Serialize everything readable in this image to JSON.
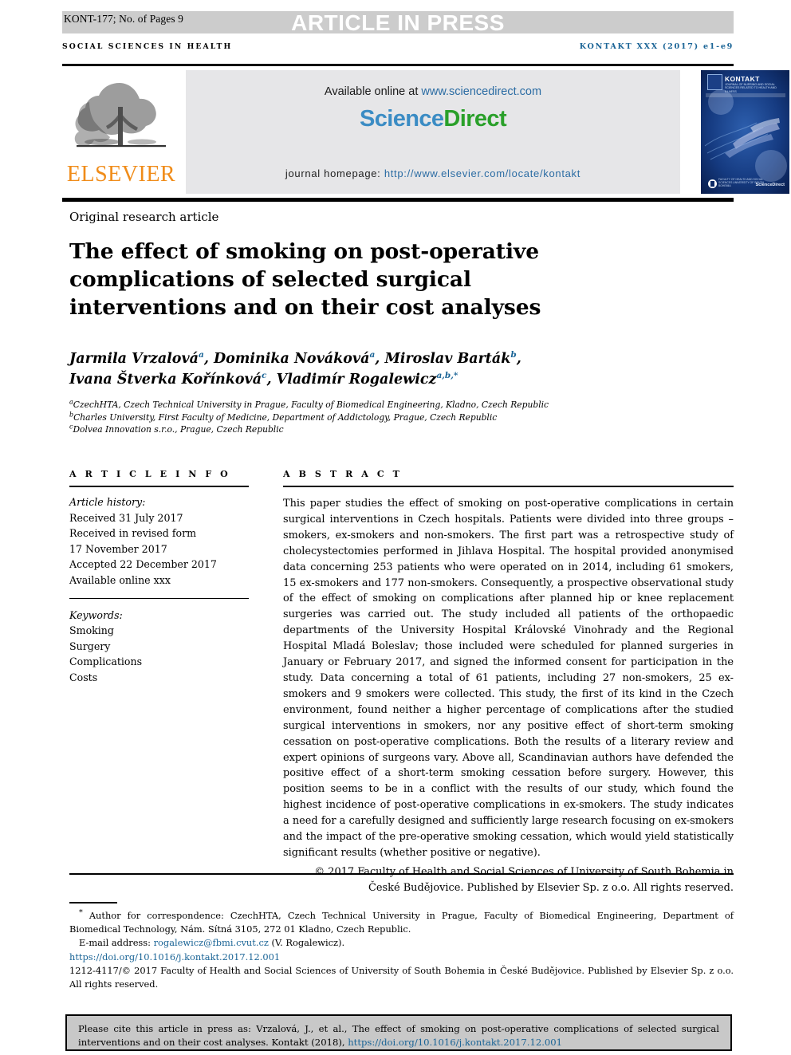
{
  "runhead": {
    "article_id": "KONT-177; No. of Pages 9",
    "press_banner": "ARTICLE IN PRESS",
    "journal_section": "SOCIAL SCIENCES IN HEALTH",
    "journal_citation": "KONTAKT XXX (2017) e1-e9"
  },
  "masthead": {
    "publisher": "ELSEVIER",
    "available_prefix": "Available online at ",
    "available_url": "www.sciencedirect.com",
    "logo_part1": "Science",
    "logo_part2": "Direct",
    "homepage_label": "journal homepage: ",
    "homepage_url": "http://www.elsevier.com/locate/kontakt",
    "cover_title": "KONTAKT",
    "cover_subtitle": "JOURNAL OF NURSING AND SOCIAL SCIENCES RELATED TO HEALTH AND ILLNESS",
    "cover_footer": "FACULTY OF HEALTH AND SOCIAL SCIENCES UNIVERSITY OF SOUTH BOHEMIA",
    "cover_sciencedirect": "ScienceDirect"
  },
  "article": {
    "type": "Original research article",
    "title": "The effect of smoking on post-operative complications of selected surgical interventions and on their cost analyses",
    "authors_line1_name1": "Jarmila Vrzalová",
    "authors_line1_sup1": "a",
    "authors_line1_name2": "Dominika Nováková",
    "authors_line1_sup2": "a",
    "authors_line1_name3": "Miroslav Barták",
    "authors_line1_sup3": "b",
    "authors_line2_name1": "Ivana Štverka Kořínková",
    "authors_line2_sup1": "c",
    "authors_line2_name2": "Vladimír Rogalewicz",
    "authors_line2_sup2": "a,b,*",
    "affiliations": [
      {
        "marker": "a",
        "text": "CzechHTA, Czech Technical University in Prague, Faculty of Biomedical Engineering, Kladno, Czech Republic"
      },
      {
        "marker": "b",
        "text": "Charles University, First Faculty of Medicine, Department of Addictology, Prague, Czech Republic"
      },
      {
        "marker": "c",
        "text": "Dolvea Innovation s.r.o., Prague, Czech Republic"
      }
    ]
  },
  "info": {
    "heading": "A R T I C L E    I N F O",
    "history_label": "Article history:",
    "history": [
      "Received 31 July 2017",
      "Received in revised form",
      "17 November 2017",
      "Accepted 22 December 2017",
      "Available online xxx"
    ],
    "keywords_label": "Keywords:",
    "keywords": [
      "Smoking",
      "Surgery",
      "Complications",
      "Costs"
    ]
  },
  "abstract": {
    "heading": "A B S T R A C T",
    "body": "This paper studies the effect of smoking on post-operative complications in certain surgical interventions in Czech hospitals. Patients were divided into three groups – smokers, ex-smokers and non-smokers. The first part was a retrospective study of cholecystectomies performed in Jihlava Hospital. The hospital provided anonymised data concerning 253 patients who were operated on in 2014, including 61 smokers, 15 ex-smokers and 177 non-smokers. Consequently, a prospective observational study of the effect of smoking on complications after planned hip or knee replacement surgeries was carried out. The study included all patients of the orthopaedic departments of the University Hospital Královské Vinohrady and the Regional Hospital Mladá Boleslav; those included were scheduled for planned surgeries in January or February 2017, and signed the informed consent for participation in the study. Data concerning a total of 61 patients, including 27 non-smokers, 25 ex-smokers and 9 smokers were collected. This study, the first of its kind in the Czech environment, found neither a higher percentage of complications after the studied surgical interventions in smokers, nor any positive effect of short-term smoking cessation on post-operative complications. Both the results of a literary review and expert opinions of surgeons vary. Above all, Scandinavian authors have defended the positive effect of a short-term smoking cessation before surgery. However, this position seems to be in a conflict with the results of our study, which found the highest incidence of post-operative complications in ex-smokers. The study indicates a need for a carefully designed and sufficiently large research focusing on ex-smokers and the impact of the pre-operative smoking cessation, which would yield statistically significant results (whether positive or negative).",
    "copyright": "© 2017 Faculty of Health and Social Sciences of University of South Bohemia in České Budějovice. Published by Elsevier Sp. z o.o. All rights reserved."
  },
  "footnote": {
    "correspondence_marker": "*",
    "correspondence": "Author for correspondence: CzechHTA, Czech Technical University in Prague, Faculty of Biomedical Engineering, Department of Biomedical Technology, Nám. Sítná 3105, 272 01 Kladno, Czech Republic.",
    "email_label": "E-mail address: ",
    "email": "rogalewicz@fbmi.cvut.cz",
    "email_suffix": " (V. Rogalewicz).",
    "doi": "https://doi.org/10.1016/j.kontakt.2017.12.001",
    "issn_line": "1212-4117/© 2017 Faculty of Health and Social Sciences of University of South Bohemia in České Budějovice. Published by Elsevier Sp. z o.o. All rights reserved."
  },
  "citation_box": {
    "text": "Please cite this article in press as: Vrzalová, J., et al., The effect of smoking on post-operative complications of selected surgical interventions and on their cost analyses. Kontakt (2018), ",
    "link": "https://doi.org/10.1016/j.kontakt.2017.12.001"
  },
  "colors": {
    "link_blue": "#1a6496",
    "elsevier_orange": "#F08C19",
    "sciencedirect_green": "#2aa02a",
    "sciencedirect_blue": "#3b8cc4",
    "banner_gray": "#cccccc",
    "panel_gray": "#e6e6e8",
    "cite_gray": "#c8c8c8"
  }
}
